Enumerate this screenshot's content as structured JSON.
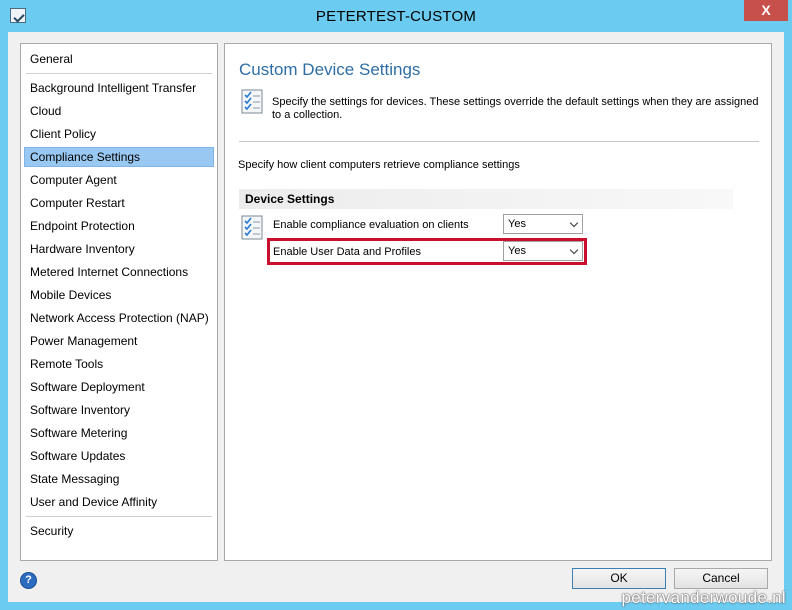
{
  "window": {
    "title": "PETERTEST-CUSTOM",
    "close_glyph": "X"
  },
  "sidebar": {
    "items": [
      "General",
      "Background Intelligent Transfer",
      "Cloud",
      "Client Policy",
      "Compliance Settings",
      "Computer Agent",
      "Computer Restart",
      "Endpoint Protection",
      "Hardware Inventory",
      "Metered Internet Connections",
      "Mobile Devices",
      "Network Access Protection (NAP)",
      "Power Management",
      "Remote Tools",
      "Software Deployment",
      "Software Inventory",
      "Software Metering",
      "Software Updates",
      "State Messaging",
      "User and Device Affinity",
      "Security"
    ],
    "selected": "Compliance Settings"
  },
  "main": {
    "heading": "Custom Device Settings",
    "description": "Specify the settings for devices. These settings override the default settings when they are assigned to a collection.",
    "subdescription": "Specify how client computers retrieve compliance settings",
    "group_header": "Device Settings",
    "settings": [
      {
        "label": "Enable compliance evaluation on clients",
        "value": "Yes"
      },
      {
        "label": "Enable User Data and Profiles",
        "value": "Yes"
      }
    ],
    "highlight_color": "#c8102e"
  },
  "footer": {
    "help_glyph": "?",
    "ok_label": "OK",
    "cancel_label": "Cancel"
  },
  "watermark": "petervanderwoude.nl",
  "colors": {
    "accent": "#6ccbf0",
    "heading": "#2e6ea5",
    "selection": "#99c8f2",
    "close": "#c7504a"
  }
}
